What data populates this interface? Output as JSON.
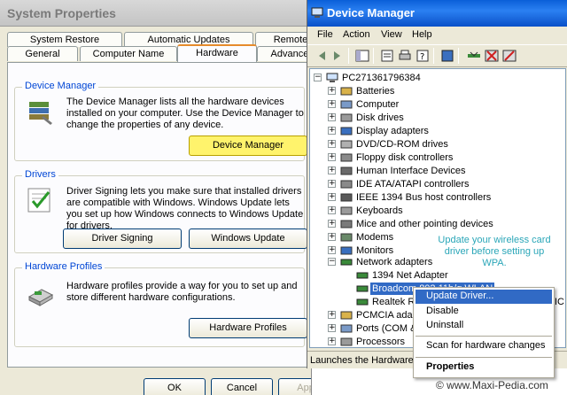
{
  "system_properties": {
    "title": "System Properties",
    "tabs_row1": [
      "System Restore",
      "Automatic Updates",
      "Remote"
    ],
    "tabs_row2": [
      "General",
      "Computer Name",
      "Hardware",
      "Advanced"
    ],
    "active_tab": "Hardware",
    "device_manager_group": {
      "legend": "Device Manager",
      "description": "The Device Manager lists all the hardware devices installed on your computer. Use the Device Manager to change the properties of any device.",
      "button": "Device Manager"
    },
    "drivers_group": {
      "legend": "Drivers",
      "description": "Driver Signing lets you make sure that installed drivers are compatible with Windows. Windows Update lets you set up how Windows connects to Windows Update for drivers.",
      "signing_button": "Driver Signing",
      "update_button": "Windows Update"
    },
    "profiles_group": {
      "legend": "Hardware Profiles",
      "description": "Hardware profiles provide a way for you to set up and store different hardware configurations.",
      "button": "Hardware Profiles"
    },
    "bottom_buttons": [
      "OK",
      "Cancel",
      "Apply"
    ]
  },
  "device_manager": {
    "title": "Device Manager",
    "menu": [
      "File",
      "Action",
      "View",
      "Help"
    ],
    "root": "PC271361796384",
    "categories": [
      "Batteries",
      "Computer",
      "Disk drives",
      "Display adapters",
      "DVD/CD-ROM drives",
      "Floppy disk controllers",
      "Human Interface Devices",
      "IDE ATA/ATAPI controllers",
      "IEEE 1394 Bus host controllers",
      "Keyboards",
      "Mice and other pointing devices",
      "Modems",
      "Monitors"
    ],
    "network_adapters": {
      "label": "Network adapters",
      "children": [
        "1394 Net Adapter",
        "Broadcom 802.11b/g WLAN",
        "Realtek R"
      ]
    },
    "after_network": [
      "PCMCIA adap",
      "Ports (COM & L",
      "Processors"
    ],
    "trailing_fragment": "IC",
    "status": "Launches the Hardware U"
  },
  "context_menu": {
    "items": [
      "Update Driver...",
      "Disable",
      "Uninstall",
      "Scan for hardware changes",
      "Properties"
    ],
    "highlighted": "Update Driver..."
  },
  "annotation": "Update your wireless card driver before setting up WPA.",
  "watermark": "© www.Maxi-Pedia.com"
}
